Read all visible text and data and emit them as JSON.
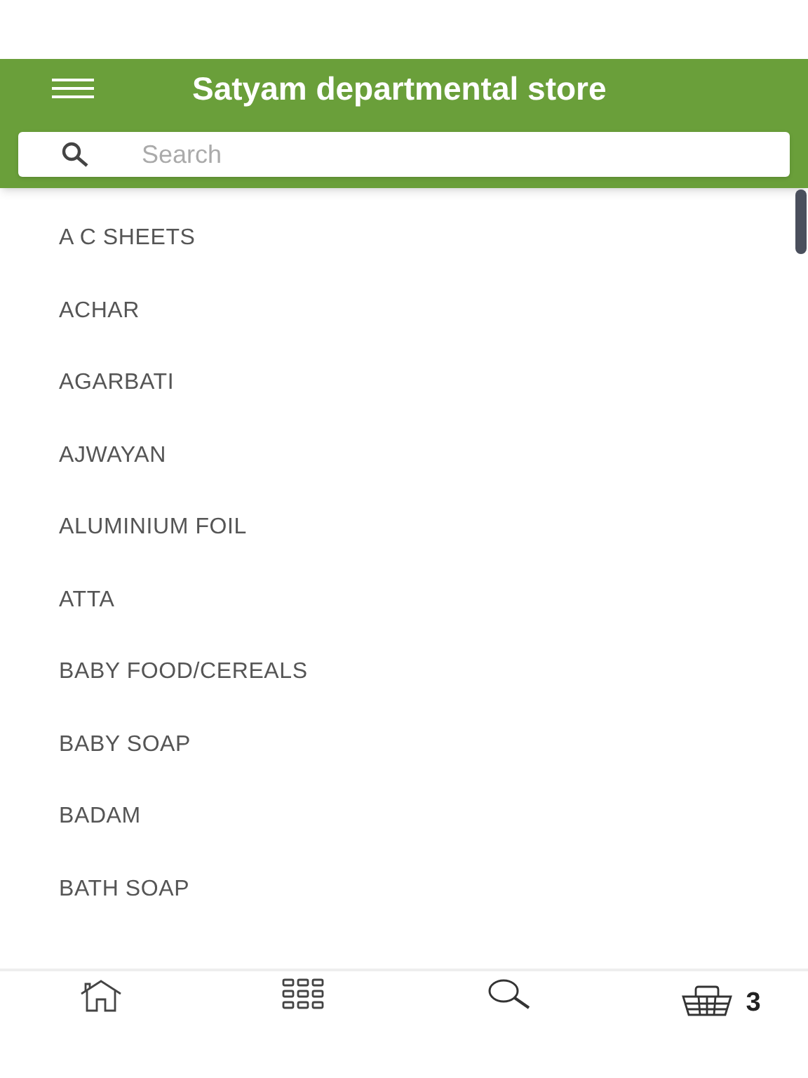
{
  "header": {
    "title": "Satyam departmental store"
  },
  "search": {
    "placeholder": "Search"
  },
  "categories": [
    "A C SHEETS",
    "ACHAR",
    "AGARBATI",
    "AJWAYAN",
    "ALUMINIUM FOIL",
    "ATTA",
    "BABY FOOD/CEREALS",
    "BABY SOAP",
    "BADAM",
    "BATH SOAP"
  ],
  "bottom_nav": {
    "cart_count": "3"
  }
}
